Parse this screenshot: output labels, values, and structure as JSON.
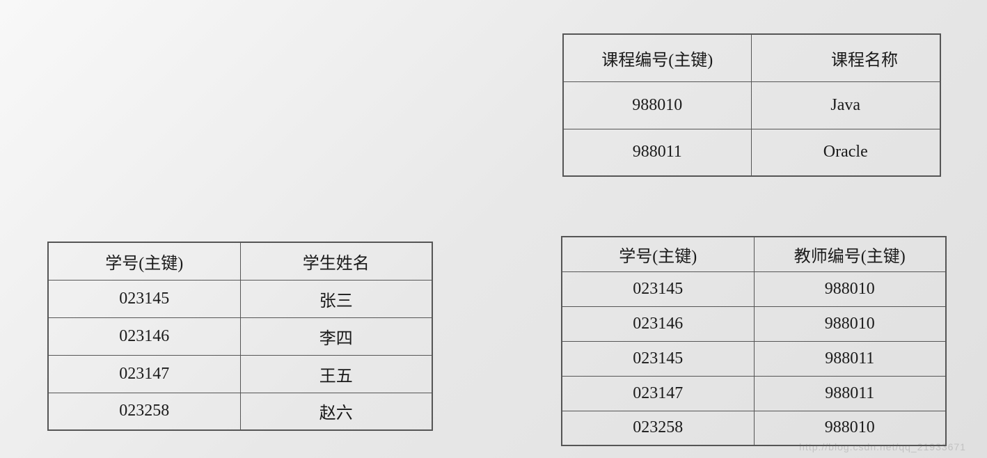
{
  "courses": {
    "headers": [
      "课程编号(主键)",
      "课程名称"
    ],
    "rows": [
      [
        "988010",
        "Java"
      ],
      [
        "988011",
        "Oracle"
      ]
    ]
  },
  "students": {
    "headers": [
      "学号(主键)",
      "学生姓名"
    ],
    "rows": [
      [
        "023145",
        "张三"
      ],
      [
        "023146",
        "李四"
      ],
      [
        "023147",
        "王五"
      ],
      [
        "023258",
        "赵六"
      ]
    ]
  },
  "enrollment": {
    "headers": [
      "学号(主键)",
      "教师编号(主键)"
    ],
    "rows": [
      [
        "023145",
        "988010"
      ],
      [
        "023146",
        "988010"
      ],
      [
        "023145",
        "988011"
      ],
      [
        "023147",
        "988011"
      ],
      [
        "023258",
        "988010"
      ]
    ]
  },
  "watermark": "http://blog.csdn.net/qq_21933671"
}
